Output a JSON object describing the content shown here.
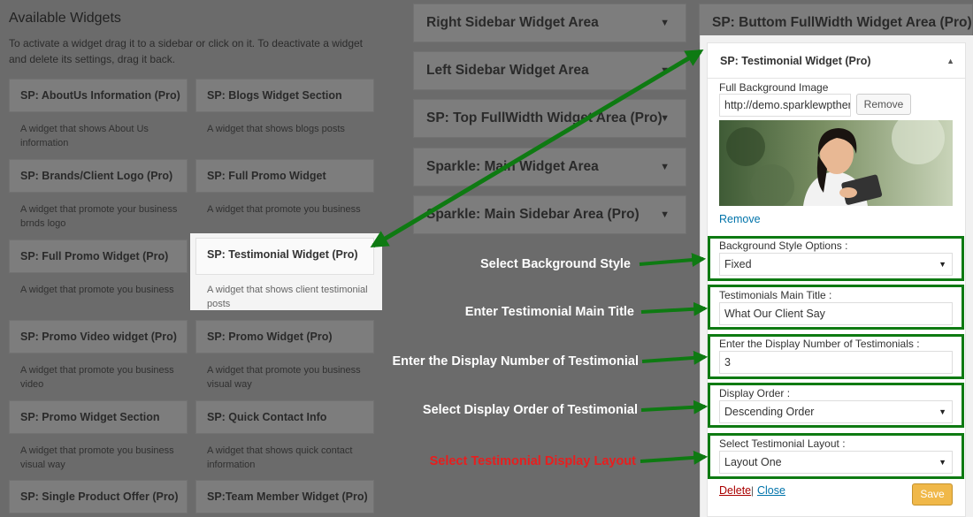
{
  "available": {
    "title": "Available Widgets",
    "description": "To activate a widget drag it to a sidebar or click on it. To deactivate a widget and delete its settings, drag it back.",
    "widgets": [
      {
        "name": "SP: AboutUs Information (Pro)",
        "desc": "A widget that shows About Us information"
      },
      {
        "name": "SP: Blogs Widget Section",
        "desc": "A widget that shows blogs posts"
      },
      {
        "name": "SP: Brands/Client Logo (Pro)",
        "desc": "A widget that promote your business brnds logo"
      },
      {
        "name": "SP: Full Promo Widget",
        "desc": "A widget that promote you business"
      },
      {
        "name": "SP: Full Promo Widget (Pro)",
        "desc": "A widget that promote you business"
      },
      {
        "name": "SP: Testimonial Widget (Pro)",
        "desc": "A widget that shows client testimonial posts"
      },
      {
        "name": "SP: Promo Video widget (Pro)",
        "desc": "A widget that promote you business video"
      },
      {
        "name": "SP: Promo Widget (Pro)",
        "desc": "A widget that promote you business visual way"
      },
      {
        "name": "SP: Promo Widget Section",
        "desc": "A widget that promote you business visual way"
      },
      {
        "name": "SP: Quick Contact Info",
        "desc": "A widget that shows quick contact information"
      },
      {
        "name": "SP: Single Product Offer (Pro)",
        "desc": ""
      },
      {
        "name": "SP:Team Member Widget (Pro)",
        "desc": ""
      }
    ]
  },
  "areas": [
    "Right Sidebar Widget Area",
    "Left Sidebar Widget Area",
    "SP: Top FullWidth Widget Area (Pro)",
    "Sparkle: Main Widget Area",
    "Sparkle: Main Sidebar Area (Pro)"
  ],
  "bottom_area": {
    "title": "SP: Buttom FullWidth Widget Area (Pro)"
  },
  "widget_form": {
    "title": "SP: Testimonial Widget (Pro)",
    "bg_image_label": "Full Background Image",
    "bg_image_value": "http://demo.sparklewpthemes.com",
    "remove_button": "Remove",
    "remove_link": "Remove",
    "bg_style_label": "Background Style Options :",
    "bg_style_value": "Fixed",
    "main_title_label": "Testimonials Main Title :",
    "main_title_value": "What Our Client Say",
    "display_number_label": "Enter the Display Number of Testimonials :",
    "display_number_value": "3",
    "order_label": "Display Order :",
    "order_value": "Descending Order",
    "layout_label": "Select Testimonial Layout :",
    "layout_value": "Layout One",
    "delete_link": "Delete",
    "separator": "|",
    "close_link": "Close",
    "save_button": "Save"
  },
  "annotations": [
    "Select Background Style",
    "Enter Testimonial Main Title",
    "Enter the Display Number of Testimonial",
    "Select Display Order of Testimonial",
    "Select Testimonial Display Layout"
  ],
  "colors": {
    "annotation_green": "#0e7a12",
    "annotation_red": "#e81e1e",
    "save": "#f0b849"
  }
}
